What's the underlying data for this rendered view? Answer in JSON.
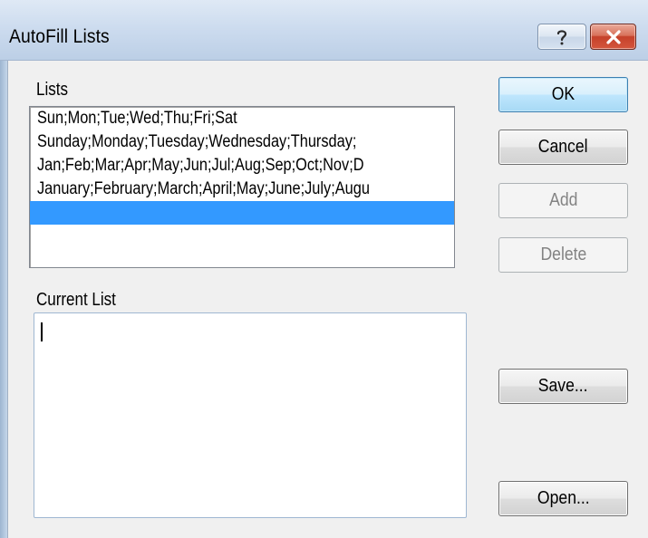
{
  "window": {
    "title": "AutoFill Lists",
    "help_glyph": "?",
    "close_glyph": "✕"
  },
  "lists": {
    "label": "Lists",
    "items": [
      "Sun;Mon;Tue;Wed;Thu;Fri;Sat",
      "Sunday;Monday;Tuesday;Wednesday;Thursday;",
      "Jan;Feb;Mar;Apr;May;Jun;Jul;Aug;Sep;Oct;Nov;D",
      "January;February;March;April;May;June;July;Augu",
      ""
    ],
    "selected_index": 4
  },
  "current_list": {
    "label": "Current List",
    "value": ""
  },
  "buttons": {
    "ok": "OK",
    "cancel": "Cancel",
    "add": "Add",
    "delete": "Delete",
    "save": "Save...",
    "open": "Open..."
  },
  "colors": {
    "selection": "#3399ff",
    "default_button_border": "#3c7fb1",
    "close_button": "#c5412a"
  }
}
